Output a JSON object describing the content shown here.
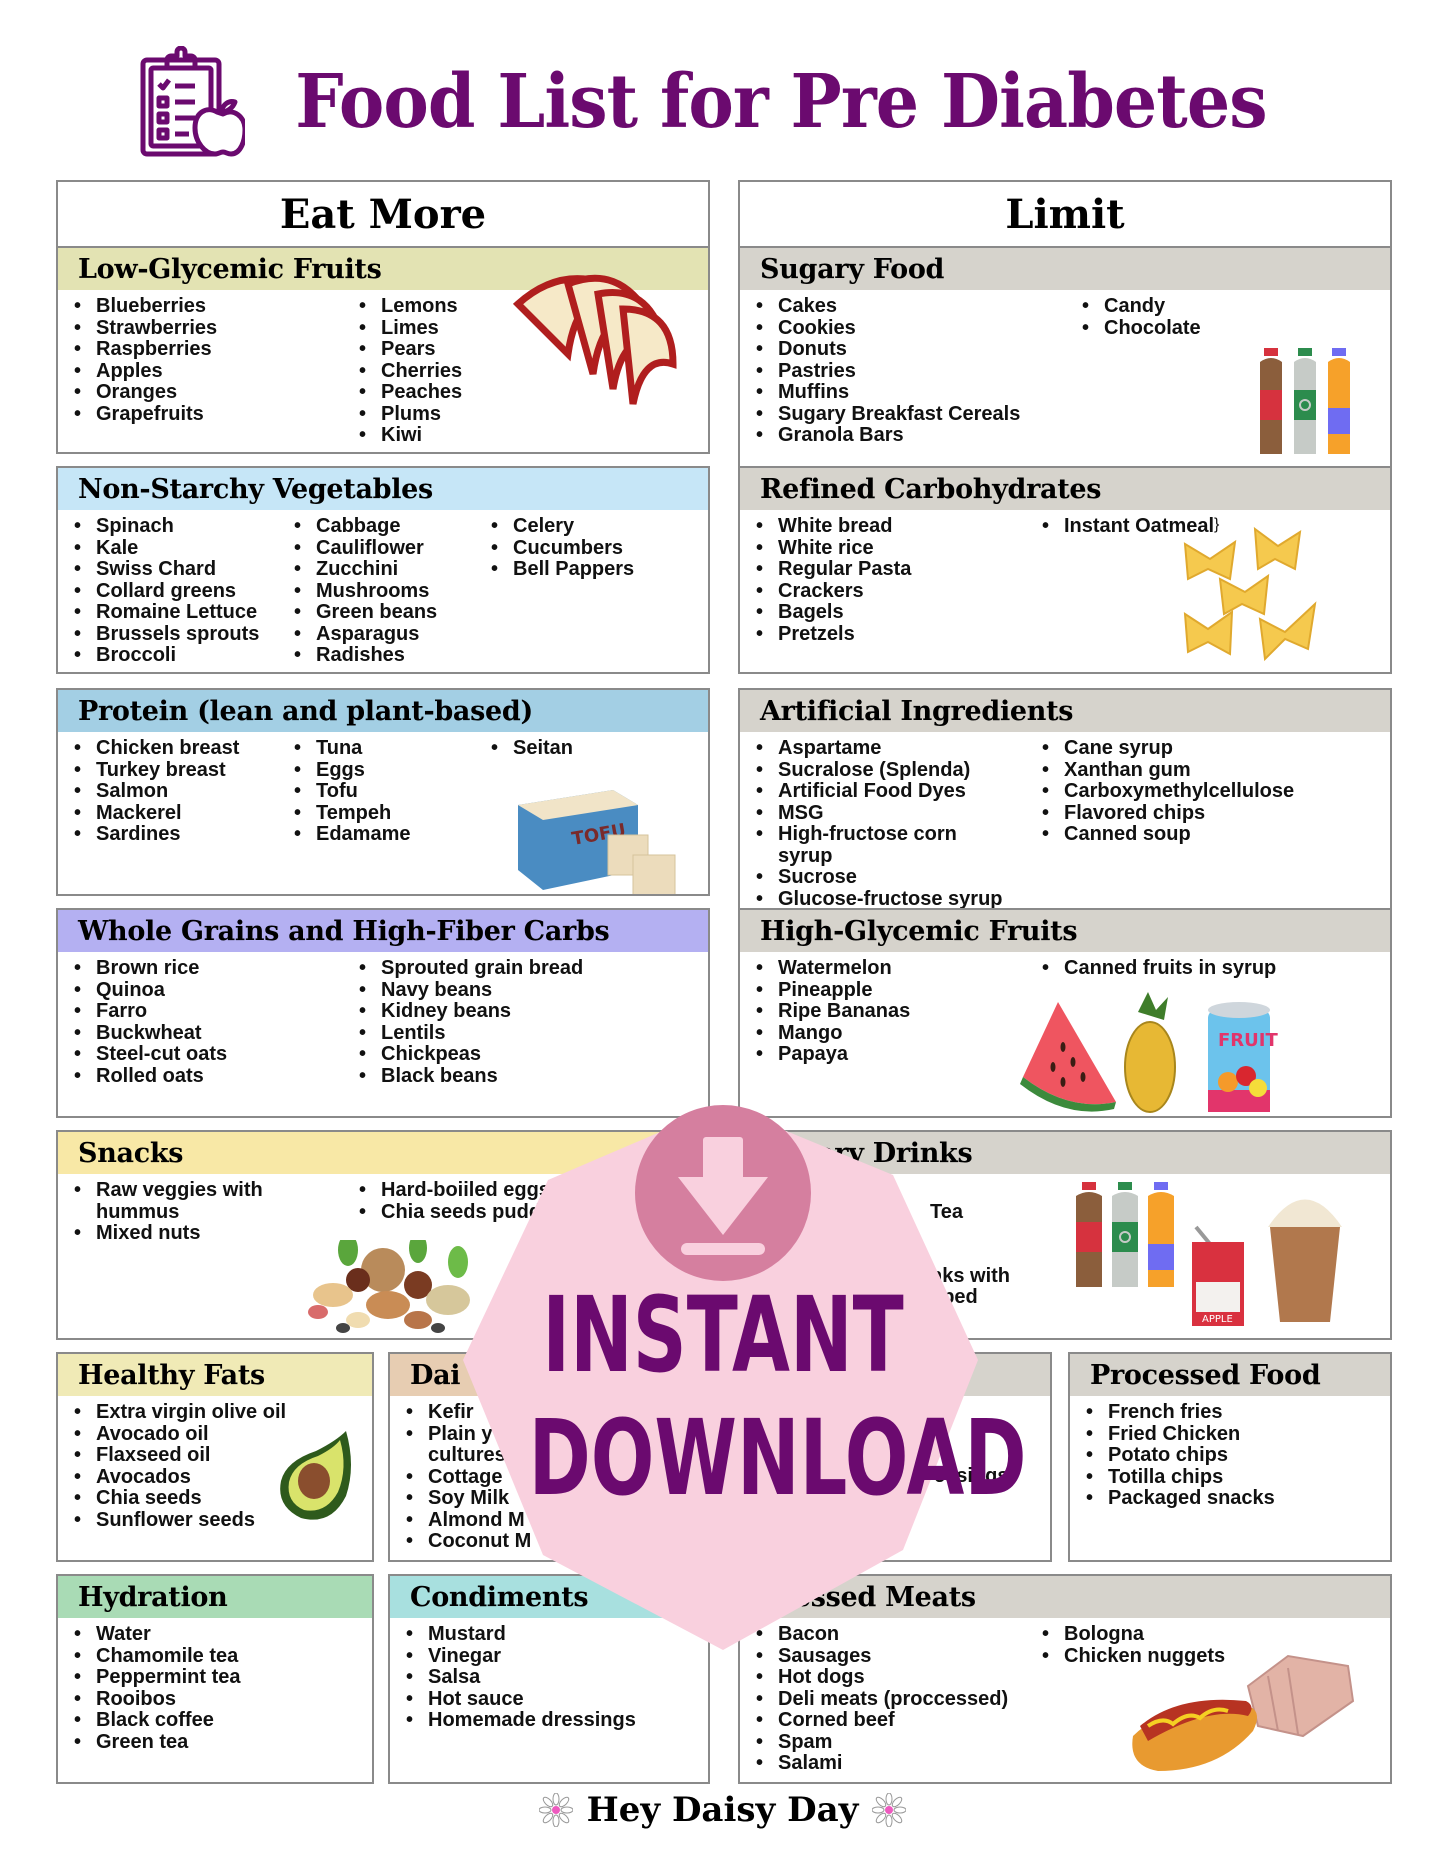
{
  "header": {
    "title": "Food List for Pre Diabetes",
    "icon": "clipboard-checklist-apple-icon",
    "accent_color": "#6b0a6f"
  },
  "columns": {
    "eat_more": "Eat More",
    "limit": "Limit"
  },
  "sections": {
    "low_glycemic_fruits": {
      "title": "Low-Glycemic Fruits",
      "color": "#e3e3b3",
      "col1": [
        "Blueberries",
        "Strawberries",
        "Raspberries",
        "Apples",
        "Oranges",
        "Grapefruits"
      ],
      "col2": [
        "Lemons",
        "Limes",
        "Pears",
        "Cherries",
        "Peaches",
        "Plums",
        "Kiwi"
      ],
      "image": "apple-slices"
    },
    "sugary_food": {
      "title": "Sugary Food",
      "color": "#d6d3cc",
      "col1": [
        "Cakes",
        "Cookies",
        "Donuts",
        "Pastries",
        "Muffins",
        "Sugary Breakfast Cereals",
        "Granola Bars"
      ],
      "col2": [
        "Candy",
        "Chocolate"
      ],
      "image": "soda-bottles"
    },
    "non_starchy_vegetables": {
      "title": "Non-Starchy Vegetables",
      "color": "#c6e6f7",
      "col1": [
        "Spinach",
        "Kale",
        "Swiss Chard",
        "Collard greens",
        "Romaine Lettuce",
        "Brussels sprouts",
        "Broccoli"
      ],
      "col2": [
        "Cabbage",
        "Cauliflower",
        "Zucchini",
        "Mushrooms",
        "Green beans",
        "Asparagus",
        "Radishes"
      ],
      "col3": [
        "Celery",
        "Cucumbers",
        "Bell Pappers"
      ]
    },
    "refined_carbohydrates": {
      "title": "Refined Carbohydrates",
      "color": "#d6d3cc",
      "col1": [
        "White bread",
        "White rice",
        "Regular Pasta",
        "Crackers",
        "Bagels",
        "Pretzels"
      ],
      "col2": [
        "Instant Oatmeal"
      ],
      "image": "bowtie-pasta"
    },
    "protein": {
      "title": "Protein (lean and plant-based)",
      "color": "#a3cfe4",
      "col1": [
        "Chicken breast",
        "Turkey breast",
        "Salmon",
        "Mackerel",
        "Sardines"
      ],
      "col2": [
        "Tuna",
        "Eggs",
        "Tofu",
        "Tempeh",
        "Edamame"
      ],
      "col3": [
        "Seitan"
      ],
      "image": "tofu",
      "image_label": "TOFU"
    },
    "artificial_ingredients": {
      "title": "Artificial Ingredients",
      "color": "#d6d3cc",
      "col1": [
        "Aspartame",
        "Sucralose (Splenda)",
        "Artificial Food Dyes",
        "MSG",
        "High-fructose corn syrup",
        "Sucrose",
        "Glucose-fructose syrup"
      ],
      "col2": [
        "Cane syrup",
        "Xanthan gum",
        "Carboxymethylcellulose",
        "Flavored chips",
        "Canned soup"
      ]
    },
    "whole_grains": {
      "title": "Whole Grains and High-Fiber Carbs",
      "color": "#b4b0f2",
      "col1": [
        "Brown rice",
        "Quinoa",
        "Farro",
        "Buckwheat",
        "Steel-cut oats",
        "Rolled oats"
      ],
      "col2": [
        "Sprouted grain bread",
        "Navy beans",
        "Kidney beans",
        "Lentils",
        "Chickpeas",
        "Black beans"
      ]
    },
    "high_glycemic_fruits": {
      "title": "High-Glycemic Fruits",
      "color": "#d6d3cc",
      "col1": [
        "Watermelon",
        "Pineapple",
        "Ripe Bananas",
        "Mango",
        "Papaya"
      ],
      "col2": [
        "Canned fruits in syrup"
      ],
      "image": "watermelon-pineapple-canned-fruit",
      "can_label": "FRUIT"
    },
    "snacks": {
      "title": "Snacks",
      "color": "#f8e8a6",
      "col1": [
        "Raw veggies with hummus",
        "Mixed nuts"
      ],
      "col2": [
        "Hard-boiiled eggs",
        "Chia seeds pudding"
      ],
      "image": "mixed-nuts"
    },
    "sugary_drinks": {
      "title": "Sugary Drinks",
      "color": "#d6d3cc",
      "visible_fragments": [
        "Tea",
        "nks with",
        "pped"
      ],
      "image": "sodas-juice-box-frappe",
      "juice_label": "APPLE"
    },
    "healthy_fats": {
      "title": "Healthy Fats",
      "color": "#f0eab6",
      "col1": [
        "Extra virgin olive oil",
        "Avocado oil",
        "Flaxseed oil",
        "Avocados",
        "Chia seeds",
        "Sunflower seeds"
      ],
      "image": "avocado"
    },
    "dairy": {
      "title": "Dai",
      "color": "#e7cdb2",
      "col1": [
        "Kefir",
        "Plain y",
        "cultures",
        "Cottage",
        "Soy Milk",
        "Almond M",
        "Coconut M"
      ]
    },
    "hidden_limit_box": {
      "title": "",
      "color": "#d6d3cc",
      "visible_fragments": [
        "essings"
      ]
    },
    "processed_food": {
      "title": "Processed Food",
      "color": "#d6d3cc",
      "col1": [
        "French fries",
        "Fried Chicken",
        "Potato chips",
        "Totilla chips",
        "Packaged snacks"
      ]
    },
    "hydration": {
      "title": "Hydration",
      "color": "#a9dbb5",
      "col1": [
        "Water",
        "Chamomile tea",
        "Peppermint tea",
        "Rooibos",
        "Black coffee",
        "Green tea"
      ]
    },
    "condiments": {
      "title": "Condiments",
      "color": "#a8e0df",
      "col1": [
        "Mustard",
        "Vinegar",
        "Salsa",
        "Hot sauce",
        "Homemade dressings"
      ]
    },
    "processed_meats": {
      "title": "ocessed Meats",
      "color": "#d6d3cc",
      "col1": [
        "Bacon",
        "Sausages",
        "Hot dogs",
        "Deli meats (proccessed)",
        "Corned beef",
        "Spam",
        "Salami"
      ],
      "col2": [
        "Bologna",
        "Chicken nuggets"
      ],
      "image": "hotdog-and-ham"
    }
  },
  "overlay": {
    "line1": "INSTANT",
    "line2": "DOWNLOAD",
    "icon": "download-icon",
    "badge_color": "#f9d0de",
    "circle_color": "#d57f9f",
    "text_color": "#6b0a6f"
  },
  "footer": {
    "brand": "Hey Daisy Day",
    "icon": "daisy-icon"
  }
}
